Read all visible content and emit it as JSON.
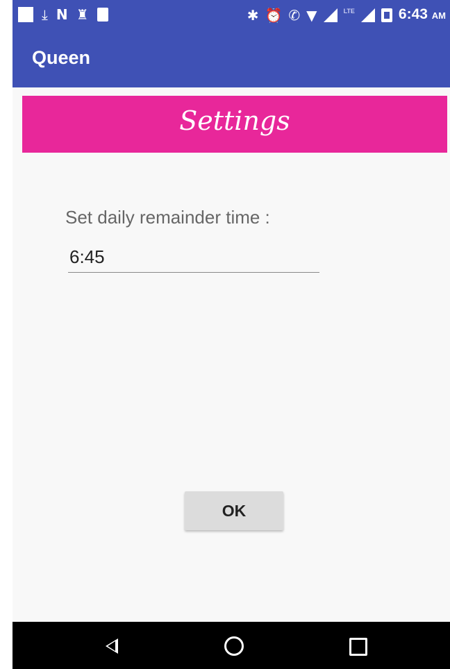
{
  "status_bar": {
    "time": "6:43",
    "ampm": "AM",
    "network_label": "LTE",
    "icons": [
      "notification-square-icon",
      "download-icon",
      "n-icon",
      "incognito-icon",
      "sim-icon",
      "bluetooth-icon",
      "alarm-icon",
      "wifi-call-icon",
      "wifi-icon",
      "signal-icon",
      "signal-lte-icon",
      "battery-icon"
    ]
  },
  "toolbar": {
    "title": "Queen"
  },
  "banner": {
    "title": "Settings"
  },
  "form": {
    "label": "Set daily remainder time :",
    "time_value": "6:45"
  },
  "actions": {
    "ok_label": "OK"
  },
  "nav_bar": {
    "icons": [
      "back-icon",
      "home-icon",
      "recents-icon"
    ]
  },
  "colors": {
    "primary": "#3f51b5",
    "accent": "#e8279a",
    "background": "#f8f8f8"
  }
}
